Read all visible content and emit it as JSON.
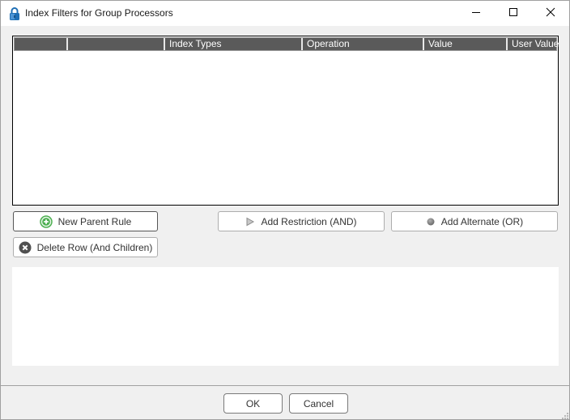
{
  "window": {
    "title": "Index Filters for Group Processors",
    "icon": "lock-icon",
    "controls": {
      "minimize": "minimize-icon",
      "maximize": "maximize-icon",
      "close": "close-icon"
    }
  },
  "grid": {
    "columns": [
      {
        "label": ""
      },
      {
        "label": ""
      },
      {
        "label": "Index Types"
      },
      {
        "label": "Operation"
      },
      {
        "label": "Value"
      },
      {
        "label": "User Value"
      }
    ],
    "rows": []
  },
  "actions": {
    "new_parent_rule": {
      "label": "New Parent Rule",
      "icon": "plus-circle-icon"
    },
    "delete_row": {
      "label": "Delete Row (And Children)",
      "icon": "x-circle-icon"
    },
    "add_restriction": {
      "label": "Add Restriction (AND)",
      "icon": "play-triangle-icon"
    },
    "add_alternate": {
      "label": "Add Alternate (OR)",
      "icon": "gray-dot-icon"
    }
  },
  "detail_panel": {
    "text": ""
  },
  "footer": {
    "ok_label": "OK",
    "cancel_label": "Cancel"
  },
  "colors": {
    "grid_header_bg": "#5a5a5a",
    "add_icon_green": "#4caf50",
    "delete_icon_gray": "#505050",
    "lock_blue": "#1f6fb5"
  }
}
